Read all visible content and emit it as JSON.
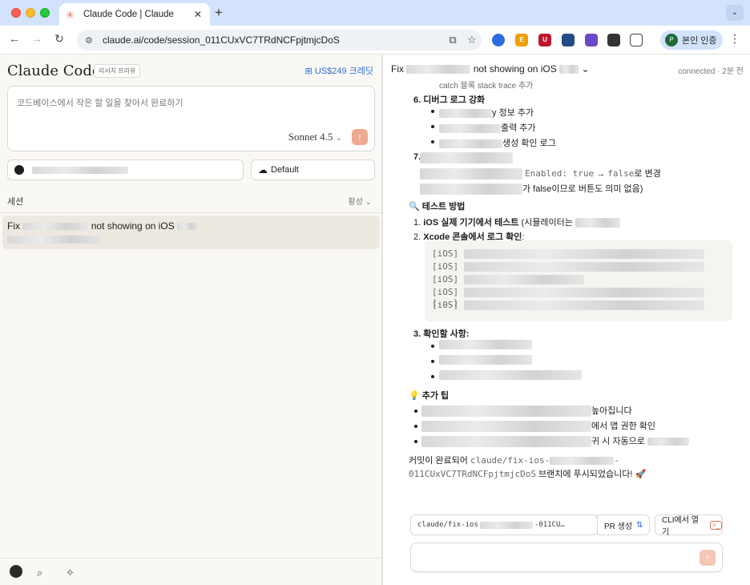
{
  "browser": {
    "tab_title": "Claude Code | Claude",
    "tab_favicon": "✳",
    "url": "claude.ai/code/session_011CUxVC7TRdNCFpjtmjcDoS",
    "profile_label": "본인 인증",
    "profile_initial": "P",
    "extensions": [
      "E",
      "E",
      "U"
    ]
  },
  "left": {
    "brand": "Claude Code",
    "badge": "리서치 프리뷰",
    "credit": "US$249 크레딧",
    "prompt_placeholder": "코드베이스에서 작은 할 일을 찾아서 완료하기",
    "model": "Sonnet 4.5",
    "branch": "Default",
    "sessions_label": "세션",
    "sessions_filter": "활성",
    "session": {
      "title_start": "Fix",
      "title_end": "not showing on iOS"
    }
  },
  "right": {
    "title_start": "Fix",
    "title_end": "not showing on iOS",
    "status": "connected · 2분 전",
    "items": {
      "clipped": "catch 블록 stack trace 추가",
      "s6": "6. 디버그 로그 강화",
      "s6a": "y 정보 추가",
      "s6b": "출력 추가",
      "s6c": "생성 확인 로그",
      "s7num": "7.",
      "s7a_code1": "Enabled: true",
      "s7a_arrow": " → ",
      "s7a_code2": "false",
      "s7a_tail": "로 변경",
      "s7b": "가 false이므로 버튼도 의미 없음)",
      "test_heading": "🔍 테스트 방법",
      "t1_num": "1. ",
      "t1_bold": "iOS 실제 기기에서 테스트",
      "t1_tail": " (시뮬레이터는",
      "t2_num": "2. ",
      "t2_bold": "Xcode 콘솔에서 로그 확인",
      "t2_tail": ":",
      "code": [
        "[iOS]",
        "[iOS]",
        "[iOS]",
        "[iOS]",
        "[iOS]"
      ],
      "code_ellipsis": "(...)",
      "t3": "3. 확인할 사항:",
      "tips_heading": "💡 추가 팁",
      "tip1": "높아집니다",
      "tip2": "에서 앱 권한 확인",
      "tip3": "귀 시 자동으로",
      "final_a": "커밋이 완료되어 ",
      "final_code1": "claude/fix-ios-",
      "final_code2": "-",
      "final_code3": "011CUxVC7TRdNCFpjtmjcDoS",
      "final_b": " 브랜치에 푸시되었습니다! 🚀"
    },
    "footer": {
      "branch_start": "claude/fix-ios",
      "branch_end": "-011CU…",
      "pr": "PR 생성",
      "cli": "CLI에서 열기"
    }
  }
}
